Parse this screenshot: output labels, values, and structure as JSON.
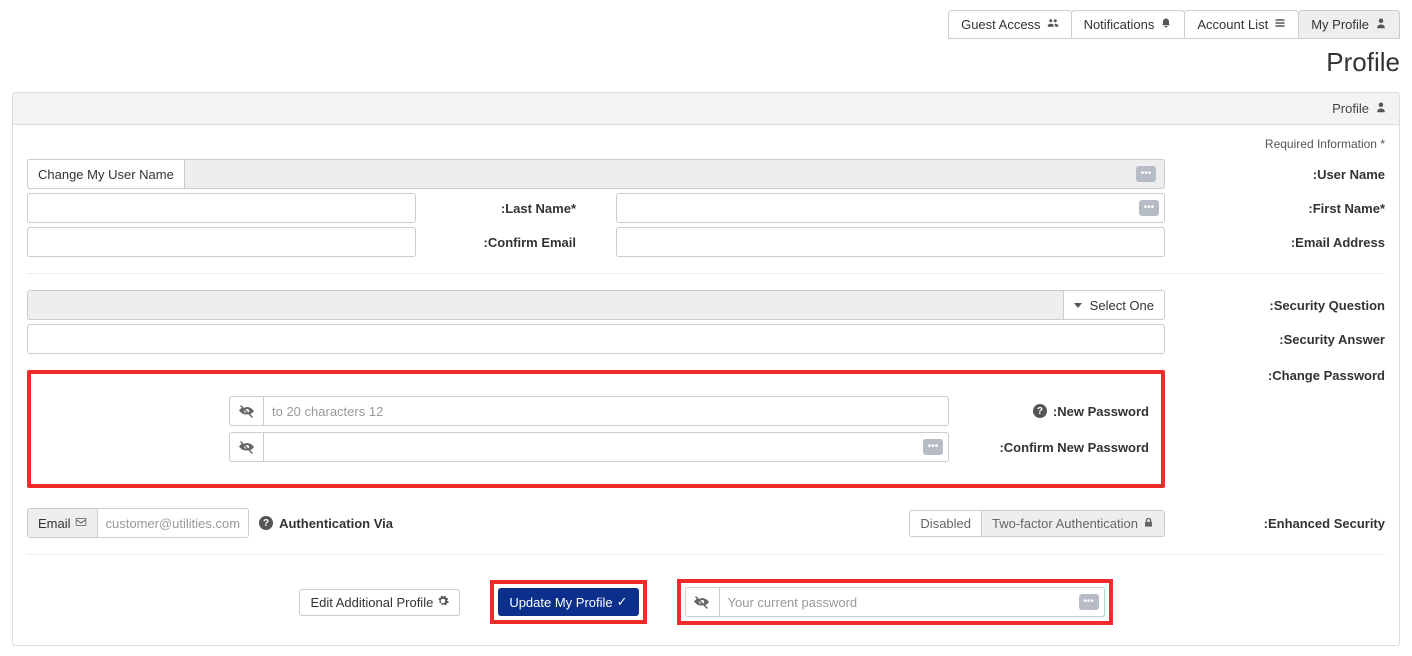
{
  "tabs": {
    "my_profile": "My Profile",
    "account_list": "Account List",
    "notifications": "Notifications",
    "guest_access": "Guest Access"
  },
  "page_title": "Profile",
  "panel_title": "Profile",
  "required_note": "* Required Information",
  "labels": {
    "user_name": "User Name:",
    "first_name": "*First Name:",
    "last_name": "*Last Name:",
    "email": "Email Address:",
    "confirm_email": "Confirm Email:",
    "security_question": "Security Question:",
    "security_answer": "Security Answer:",
    "change_password": "Change Password:",
    "new_password": "New Password:",
    "confirm_new_password": "Confirm New Password:",
    "enhanced_security": "Enhanced Security:",
    "auth_via": "Authentication Via"
  },
  "buttons": {
    "change_username": "Change My User Name",
    "select_one": "Select One",
    "tfa_label": "Two-factor Authentication",
    "tfa_status": "Disabled",
    "email_btn": "Email",
    "update_profile": "Update My Profile",
    "edit_additional": "Edit Additional Profile"
  },
  "placeholders": {
    "new_password": "12 to 20 characters",
    "confirm_password": "",
    "current_password": "Your current password"
  },
  "values": {
    "auth_email": "customer@utilities.com"
  },
  "icons": {
    "dots": "•••",
    "info": "?",
    "check": "✓",
    "gear": "⚙",
    "user": "👤",
    "list": "≣",
    "bell": "🔔",
    "users": "👥",
    "lock": "🔒",
    "envelope": "✉",
    "eye": "👁"
  }
}
